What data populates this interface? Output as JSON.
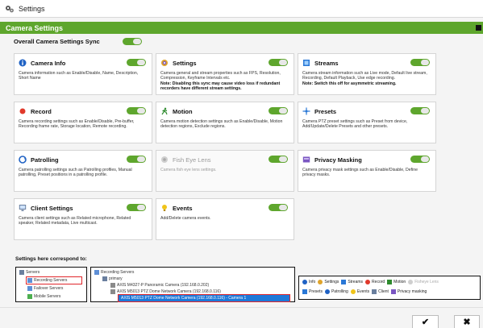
{
  "window": {
    "title": "Settings"
  },
  "header": {
    "title": "Camera Settings"
  },
  "sync": {
    "label": "Overall Camera Settings Sync",
    "enabled": true
  },
  "cards": [
    {
      "id": "camera-info",
      "title": "Camera Info",
      "icon": "info-icon",
      "enabled": true,
      "disabled": false,
      "desc": "Camera information such as Enable/Disable, Name, Description, Short Name",
      "note": ""
    },
    {
      "id": "settings",
      "title": "Settings",
      "icon": "settings-gear-icon",
      "enabled": true,
      "disabled": false,
      "desc": "Camera general and stream properties such as FPS, Resolution, Compression, Keyframe Intervals etc.",
      "note": "Note: Disabling this sync may cause video loss if redundant recorders have different stream settings."
    },
    {
      "id": "streams",
      "title": "Streams",
      "icon": "streams-icon",
      "enabled": true,
      "disabled": false,
      "desc": "Camera stream information such as Live mode, Default live stream, Recording, Default Playback, Use edge recording.",
      "note": "Note: Switch this off for asymmetric streaming."
    },
    {
      "id": "record",
      "title": "Record",
      "icon": "record-icon",
      "enabled": true,
      "disabled": false,
      "desc": "Camera recording settings such as Enable/Disable, Pre-buffer, Recording frame rate, Storage location, Remote recording.",
      "note": ""
    },
    {
      "id": "motion",
      "title": "Motion",
      "icon": "motion-icon",
      "enabled": true,
      "disabled": false,
      "desc": "Camera motion detection settings such as Enable/Disable, Motion detection regions, Exclude regions.",
      "note": ""
    },
    {
      "id": "presets",
      "title": "Presets",
      "icon": "presets-icon",
      "enabled": true,
      "disabled": false,
      "desc": "Camera PTZ preset settings such as Preset from device, Add/Update/Delete Presets and other presets.",
      "note": ""
    },
    {
      "id": "patrolling",
      "title": "Patrolling",
      "icon": "patrolling-icon",
      "enabled": true,
      "disabled": false,
      "desc": "Camera patrolling settings such as Patrolling profiles, Manual patrolling, Preset positions in a patrolling profile.",
      "note": ""
    },
    {
      "id": "fish-eye",
      "title": "Fish Eye Lens",
      "icon": "fisheye-icon",
      "enabled": true,
      "disabled": true,
      "desc": "Camera fish eye lens settings.",
      "note": ""
    },
    {
      "id": "privacy-masking",
      "title": "Privacy Masking",
      "icon": "privacy-mask-icon",
      "enabled": true,
      "disabled": false,
      "desc": "Camera privacy mask settings such as Enable/Disable, Define privacy masks.",
      "note": ""
    },
    {
      "id": "client-settings",
      "title": "Client Settings",
      "icon": "client-icon",
      "enabled": true,
      "disabled": false,
      "desc": "Camera client settings such as Related microphone, Related speaker, Related metadata, Live multicast.",
      "note": ""
    },
    {
      "id": "events",
      "title": "Events",
      "icon": "events-icon",
      "enabled": true,
      "disabled": false,
      "desc": "Add/Delete camera events.",
      "note": ""
    }
  ],
  "correspond": {
    "label": "Settings here correspond to:",
    "tree1": [
      "Servers",
      "Recording Servers",
      "Failover Servers",
      "Mobile Servers"
    ],
    "tree2": [
      "Recording Servers",
      "primary",
      "AXIS M4327-P Panoramic Camera (192.168.0.202)",
      "AXIS M5013 PTZ Dome Network Camera (192.168.0.116)",
      "AXIS M5013 PTZ Dome Network Camera (192.168.0.116) - Camera 1"
    ],
    "legend_row1": [
      "Info",
      "Settings",
      "Streams",
      "Record",
      "Motion",
      "Fisheye Lens"
    ],
    "legend_row2": [
      "Presets",
      "Patrolling",
      "Events",
      "Client",
      "Privacy masking"
    ]
  },
  "footer": {
    "ok_label": "✔",
    "cancel_label": "✖"
  },
  "colors": {
    "accent": "#5ea62d",
    "selection": "#1e78d8",
    "highlight": "#e0262b"
  }
}
